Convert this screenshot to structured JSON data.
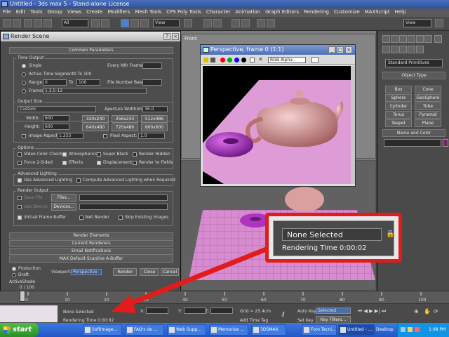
{
  "window": {
    "title": "Untitled - 3ds max 5 - Stand-alone License"
  },
  "menu": [
    "File",
    "Edit",
    "Tools",
    "Group",
    "Views",
    "Create",
    "Modifiers",
    "Mesh Tools",
    "CPS Poly Tools",
    "Character",
    "Animation",
    "Graph Editors",
    "Rendering",
    "Customize",
    "MAXScript",
    "Help"
  ],
  "toolbar": {
    "selection_filter": "All",
    "ref_coord": "View",
    "view_right": "View"
  },
  "viewports": {
    "top_label": "Front",
    "persp_label": ""
  },
  "command_panel": {
    "dropdown": "Standard Primitives",
    "object_type": "Object Type",
    "buttons": [
      "Box",
      "Cone",
      "Sphere",
      "GeoSphere",
      "Cylinder",
      "Tube",
      "Torus",
      "Pyramid",
      "Teapot",
      "Plane"
    ],
    "name_and_color": "Name and Color",
    "accent_color": "#7a1f5f"
  },
  "render_scene": {
    "title": "Render Scene",
    "common_parameters": "Common Parameters",
    "time_output": {
      "label": "Time Output",
      "single": "Single",
      "every_nth": "Every Nth Frame:",
      "active_segment": "Active Time Segment:",
      "active_range": "0 To 100",
      "range": "Range:",
      "range_from": "0",
      "range_to_label": "To",
      "range_to": "100",
      "file_number_base": "File Number Base:",
      "frames": "Frames",
      "frames_value": "1,3,5-12"
    },
    "output_size": {
      "label": "Output Size",
      "preset": "Custom",
      "aperture_label": "Aperture Width(mm):",
      "aperture": "36.0",
      "width_label": "Width:",
      "width": "800",
      "height_label": "Height:",
      "height": "600",
      "presets": [
        "320x240",
        "256x243",
        "512x486",
        "640x480",
        "720x486",
        "800x600"
      ],
      "image_aspect_label": "Image Aspect:",
      "image_aspect": "1.333",
      "pixel_aspect_label": "Pixel Aspect:",
      "pixel_aspect": "1.0"
    },
    "options": {
      "label": "Options",
      "items": [
        "Video Color Check",
        "Atmospherics",
        "Super Black",
        "Render Hidden",
        "Force 2-Sided",
        "Effects",
        "Displacement",
        "Render to Fields"
      ]
    },
    "advanced_lighting": {
      "label": "Advanced Lighting",
      "use": "Use Advanced Lighting",
      "compute": "Compute Advanced Lighting when Required"
    },
    "render_output": {
      "label": "Render Output",
      "save_file": "Save File",
      "files_btn": "Files...",
      "use_device": "Use Device",
      "devices_btn": "Devices...",
      "vfb": "Virtual Frame Buffer",
      "net_render": "Net Render",
      "skip_existing": "Skip Existing Images"
    },
    "rollouts": [
      "Render Elements",
      "Current Renderers",
      "Email Notifications",
      "MAX Default Scanline A-Buffer"
    ],
    "bottom": {
      "production": "Production",
      "draft": "Draft",
      "activeshade": "ActiveShade",
      "viewport_label": "Viewport:",
      "viewport_value": "Perspective",
      "render_btn": "Render",
      "close_btn": "Close",
      "cancel_btn": "Cancel"
    }
  },
  "frame_window": {
    "title": "Perspective, frame 0 (1:1)",
    "channel": "RGB Alpha",
    "swatches": [
      "#ff0000",
      "#00aa00",
      "#0000ff",
      "#000000"
    ]
  },
  "callout": {
    "none_selected": "None Selected",
    "rendering_time": "Rendering Time  0:00:02"
  },
  "timeline": {
    "counter": "0 / 100",
    "ticks": [
      "0",
      "10",
      "20",
      "30",
      "40",
      "50",
      "60",
      "70",
      "80",
      "90",
      "100"
    ]
  },
  "status": {
    "none_selected": "None Selected",
    "rendering_time": "Rendering Time  0:00:02",
    "x_label": "X:",
    "y_label": "Y:",
    "z_label": "Z:",
    "grid": "Grid = 25.4cm",
    "add_time_tag": "Add Time Tag",
    "auto_key": "Auto Key",
    "selected": "Selected",
    "set_key": "Set Key",
    "key_filters": "Key Filters..."
  },
  "taskbar": {
    "start": "start",
    "tasks": [
      "Softimage...",
      "FAQ's de ...",
      "Web Supp...",
      "Memorias ...",
      "3DSMAX",
      "Foro Tecni...",
      "Untitled - ..."
    ],
    "desktop": "Desktop",
    "clock": "1:08 PM"
  },
  "colors": {
    "annotation_red": "#e21b1b",
    "teapot": "#d9a0a0",
    "torus": "#b033c0"
  }
}
